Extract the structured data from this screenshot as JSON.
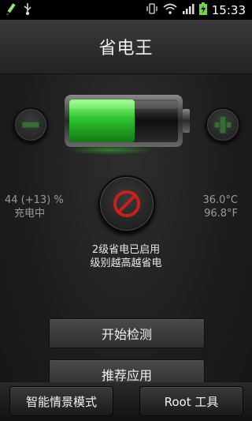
{
  "status_bar": {
    "time": "15:33",
    "icons": [
      "pencil-icon",
      "usb-icon",
      "vibrate-icon",
      "wifi-icon",
      "signal-icon",
      "battery-charging-icon"
    ]
  },
  "header": {
    "title": "省电王"
  },
  "battery": {
    "level_fraction": 0.6,
    "accent": "#3fd43f"
  },
  "stats": {
    "percent": "44 (+13) %",
    "charging": "充电中",
    "temp_c": "36.0°C",
    "temp_f": "96.8°F"
  },
  "mode": {
    "line1": "2级省电已启用",
    "line2": "级别越高越省电"
  },
  "buttons": {
    "start_check": "开始检测",
    "recommend_apps": "推荐应用"
  },
  "bottom": {
    "smart_mode": "智能情景模式",
    "root_tools": "Root 工具"
  },
  "colors": {
    "background": "#1a1a1a",
    "accent_green": "#3fd43f",
    "center_red": "#c8201a"
  }
}
